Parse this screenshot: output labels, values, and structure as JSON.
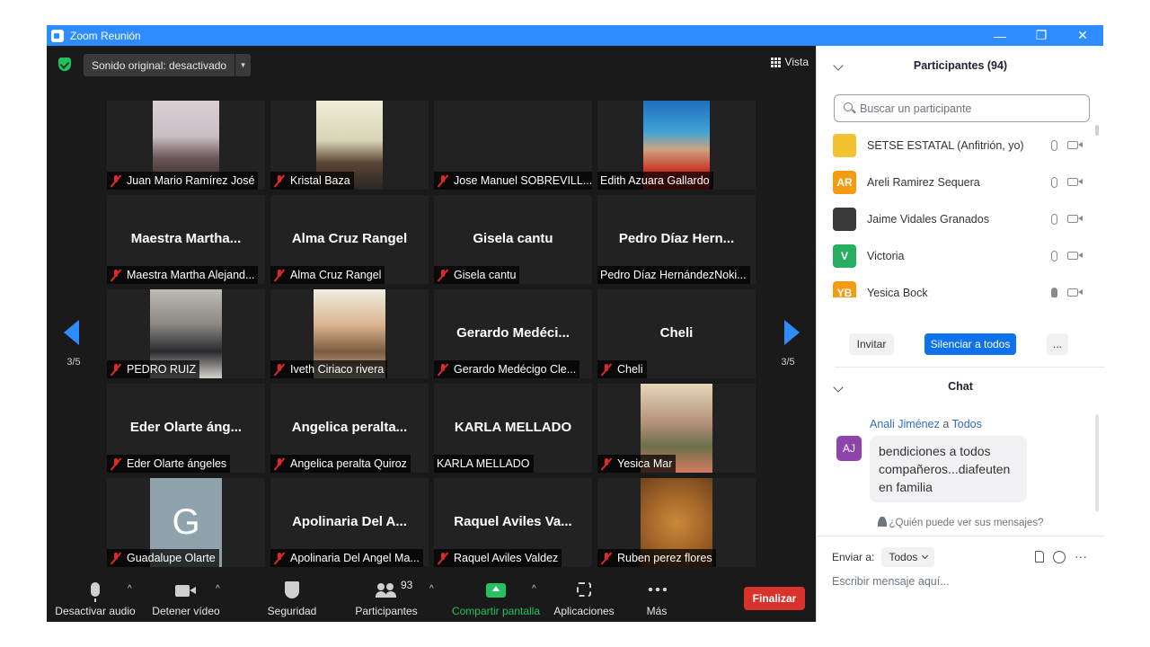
{
  "window": {
    "title": "Zoom Reunión",
    "minimize": "—",
    "restore": "❐",
    "close": "✕"
  },
  "topbar": {
    "sound_label": "Sonido original: desactivado",
    "view_label": "Vista"
  },
  "pagination": {
    "left": "3/5",
    "right": "3/5"
  },
  "tiles": [
    {
      "display": "",
      "name": "Juan Mario Ramírez José",
      "muted": true,
      "photo": "juan"
    },
    {
      "display": "",
      "name": "Kristal Baza",
      "muted": true,
      "photo": "kristal"
    },
    {
      "display": "",
      "name": "Jose Manuel SOBREVILL...",
      "muted": true,
      "photo": ""
    },
    {
      "display": "",
      "name": "Edith Azuara Gallardo",
      "muted": false,
      "photo": "edith"
    },
    {
      "display": "Maestra  Martha...",
      "name": "Maestra Martha Alejand...",
      "muted": true,
      "photo": ""
    },
    {
      "display": "Alma Cruz Rangel",
      "name": "Alma Cruz Rangel",
      "muted": true,
      "photo": ""
    },
    {
      "display": "Gisela cantu",
      "name": "Gisela cantu",
      "muted": true,
      "photo": ""
    },
    {
      "display": "Pedro  Díaz  Hern...",
      "name": "Pedro Díaz HernándezNoki...",
      "muted": false,
      "photo": ""
    },
    {
      "display": "",
      "name": "PEDRO RUIZ",
      "muted": true,
      "photo": "pedro"
    },
    {
      "display": "",
      "name": "Iveth Ciriaco rivera",
      "muted": true,
      "photo": "iveth"
    },
    {
      "display": "Gerardo  Medéci...",
      "name": "Gerardo Medécigo Cle...",
      "muted": true,
      "photo": ""
    },
    {
      "display": "Cheli",
      "name": "Cheli",
      "muted": true,
      "photo": ""
    },
    {
      "display": "Eder  Olarte  áng...",
      "name": "Eder Olarte ángeles",
      "muted": true,
      "photo": ""
    },
    {
      "display": "Angelica  peralta...",
      "name": "Angelica peralta Quiroz",
      "muted": true,
      "photo": ""
    },
    {
      "display": "KARLA MELLADO",
      "name": "KARLA MELLADO",
      "muted": false,
      "photo": ""
    },
    {
      "display": "",
      "name": "Yesica Mar",
      "muted": true,
      "photo": "yesica"
    },
    {
      "display": "",
      "name": "Guadalupe Olarte",
      "muted": true,
      "photo": "g",
      "initial": "G"
    },
    {
      "display": "Apolinaria  Del  A...",
      "name": "Apolinaria Del Angel Ma...",
      "muted": true,
      "photo": ""
    },
    {
      "display": "Raquel  Aviles  Va...",
      "name": "Raquel Aviles Valdez",
      "muted": true,
      "photo": ""
    },
    {
      "display": "",
      "name": "Ruben perez flores",
      "muted": true,
      "photo": "ruben"
    }
  ],
  "toolbar": {
    "mute_audio": "Desactivar audio",
    "stop_video": "Detener vídeo",
    "security": "Seguridad",
    "participants": "Participantes",
    "participants_count": "93",
    "share_screen": "Compartir pantalla",
    "apps": "Aplicaciones",
    "more": "Más",
    "end": "Finalizar",
    "caret": "^"
  },
  "participants_panel": {
    "title": "Participantes (94)",
    "search_placeholder": "Buscar un participante",
    "items": [
      {
        "name": "SETSE ESTATAL (Anfitrión, yo)",
        "initials": "",
        "color": "#f2c230",
        "mic_on": false
      },
      {
        "name": "Areli Ramirez Sequera",
        "initials": "AR",
        "color": "#f39c12",
        "mic_on": false
      },
      {
        "name": "Jaime Vidales Granados",
        "initials": "",
        "color": "#3a3a3a",
        "mic_on": false
      },
      {
        "name": "Victoria",
        "initials": "V",
        "color": "#27ae60",
        "mic_on": false
      },
      {
        "name": "Yesica Bock",
        "initials": "YB",
        "color": "#f39c12",
        "mic_on": true
      }
    ],
    "invite": "Invitar",
    "mute_all": "Silenciar a todos",
    "more": "..."
  },
  "chat": {
    "title": "Chat",
    "messages": [
      {
        "sender": "Anali Jiménez",
        "to_word": "a",
        "recipient": "Todos",
        "initials": "AJ",
        "text": "bendiciones a todos compañeros...diafeuten en familia"
      }
    ],
    "who_can_see": "¿Quién puede ver sus mensajes?",
    "send_to_label": "Enviar a:",
    "send_to_value": "Todos",
    "input_placeholder": "Escribir mensaje aquí...",
    "more": "···"
  }
}
